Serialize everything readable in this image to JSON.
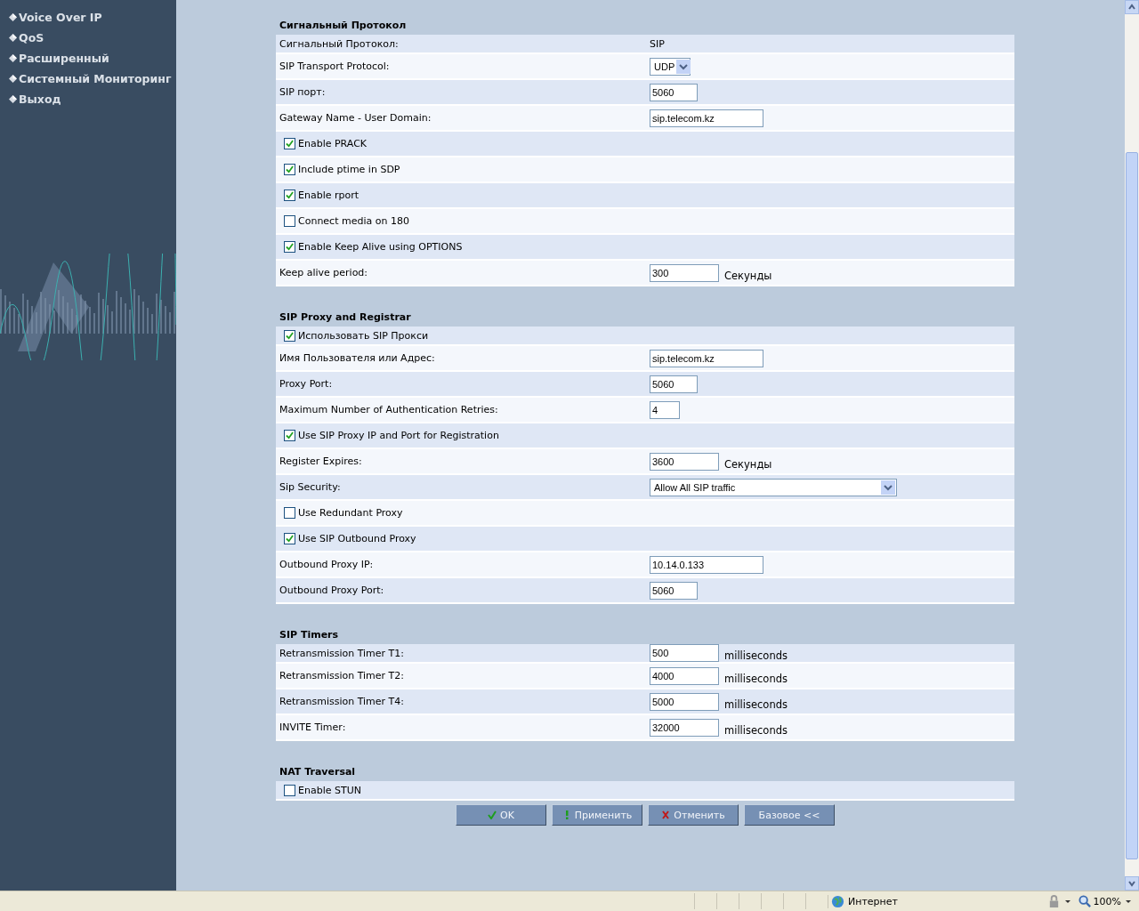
{
  "sidebar": {
    "items": [
      {
        "label": "Voice Over IP"
      },
      {
        "label": "QoS"
      },
      {
        "label": "Расширенный"
      },
      {
        "label": "Системный Мониторинг"
      },
      {
        "label": "Выход"
      }
    ]
  },
  "sections": [
    {
      "title": "Сигнальный Протокол",
      "rows": [
        {
          "kind": "text",
          "label": "Сигнальный Протокол:",
          "value": "SIP"
        },
        {
          "kind": "select",
          "label": "SIP Transport Protocol:",
          "value": "UDP"
        },
        {
          "kind": "input",
          "label": "SIP порт:",
          "value": "5060"
        },
        {
          "kind": "input",
          "label": "Gateway Name - User Domain:",
          "value": "sip.telecom.kz"
        },
        {
          "kind": "checkbox",
          "label": "Enable PRACK",
          "checked": true
        },
        {
          "kind": "checkbox",
          "label": "Include ptime in SDP",
          "checked": true
        },
        {
          "kind": "checkbox",
          "label": "Enable rport",
          "checked": true
        },
        {
          "kind": "checkbox",
          "label": "Connect media on 180",
          "checked": false
        },
        {
          "kind": "checkbox",
          "label": "Enable Keep Alive using OPTIONS",
          "checked": true
        },
        {
          "kind": "input",
          "label": "Keep alive period:",
          "value": "300",
          "unit": "Секунды"
        }
      ]
    },
    {
      "title": "SIP Proxy and Registrar",
      "rows": [
        {
          "kind": "checkbox",
          "label": "Использовать SIP Прокси",
          "checked": true
        },
        {
          "kind": "input",
          "label": "Имя Пользователя или Адрес:",
          "value": "sip.telecom.kz"
        },
        {
          "kind": "input",
          "label": "Proxy Port:",
          "value": "5060"
        },
        {
          "kind": "input",
          "label": "Maximum Number of Authentication Retries:",
          "value": "4"
        },
        {
          "kind": "checkbox",
          "label": "Use SIP Proxy IP and Port for Registration",
          "checked": true
        },
        {
          "kind": "input",
          "label": "Register Expires:",
          "value": "3600",
          "unit": "Секунды"
        },
        {
          "kind": "select",
          "label": "Sip Security:",
          "value": "Allow All SIP traffic"
        },
        {
          "kind": "checkbox",
          "label": "Use Redundant Proxy",
          "checked": false
        },
        {
          "kind": "checkbox",
          "label": "Use SIP Outbound Proxy",
          "checked": true
        },
        {
          "kind": "input",
          "label": "Outbound Proxy IP:",
          "value": "10.14.0.133"
        },
        {
          "kind": "input",
          "label": "Outbound Proxy Port:",
          "value": "5060"
        }
      ]
    },
    {
      "title": "SIP Timers",
      "rows": [
        {
          "kind": "input",
          "label": "Retransmission Timer T1:",
          "value": "500",
          "unit": "milliseconds"
        },
        {
          "kind": "input",
          "label": "Retransmission Timer T2:",
          "value": "4000",
          "unit": "milliseconds"
        },
        {
          "kind": "input",
          "label": "Retransmission Timer T4:",
          "value": "5000",
          "unit": "milliseconds"
        },
        {
          "kind": "input",
          "label": "INVITE Timer:",
          "value": "32000",
          "unit": "milliseconds"
        }
      ]
    },
    {
      "title": "NAT Traversal",
      "rows": [
        {
          "kind": "checkbox",
          "label": "Enable STUN",
          "checked": false
        }
      ]
    }
  ],
  "buttons": [
    {
      "kind": "ok",
      "label": "OK"
    },
    {
      "kind": "apply",
      "label": "Применить"
    },
    {
      "kind": "cancel",
      "label": "Отменить"
    },
    {
      "kind": "plain",
      "label": "Базовое <<"
    }
  ],
  "status_bar": {
    "zone": "Интернет",
    "zoom": "100%"
  }
}
